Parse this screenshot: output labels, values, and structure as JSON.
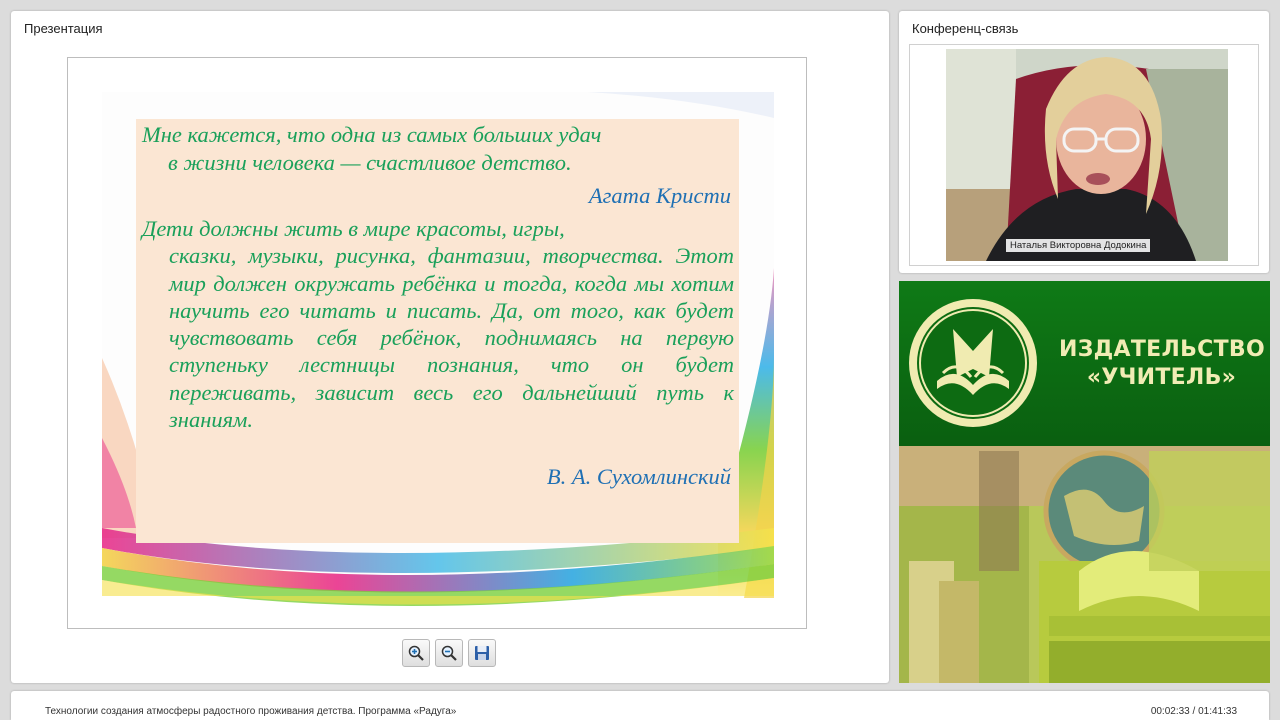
{
  "presentation": {
    "title": "Презентация",
    "slide": {
      "quote1_line1": "Мне кажется, что одна из самых больших удач",
      "quote1_line2": "в жизни человека — счастливое детство.",
      "author1": "Агата Кристи",
      "quote2_first": "Дети должны жить в мире красоты, игры,",
      "quote2_rest": "сказки, музыки, рисунка, фантазии, творчества. Этот мир должен окружать ребёнка и тогда, когда мы хотим научить его читать и писать. Да, от того, как будет чувствовать себя ребёнок, поднимаясь на первую ступеньку лестницы познания, что он будет переживать, зависит весь его дальнейший путь к знаниям.",
      "author2": "В. А. Сухомлинский"
    },
    "toolbar": {
      "zoom_in_icon": "zoom-in-icon",
      "zoom_out_icon": "zoom-out-icon",
      "save_icon": "save-icon"
    }
  },
  "conference": {
    "title": "Конференц-связь",
    "speaker_name": "Наталья Викторовна Додокина"
  },
  "ad": {
    "publisher_line1": "ИЗДАТЕЛЬСТВО",
    "publisher_line2": "«УЧИТЕЛЬ»"
  },
  "footer": {
    "webinar_title": "Технологии создания атмосферы радостного проживания детства. Программа «Радуга»",
    "time": "00:02:33 / 01:41:33"
  },
  "colors": {
    "quote_green": "#1aa05a",
    "author_blue": "#1f70b4",
    "slide_bg": "#fbe6d3",
    "ad_green": "#0d6b12",
    "publisher_text": "#f1ecb4"
  }
}
